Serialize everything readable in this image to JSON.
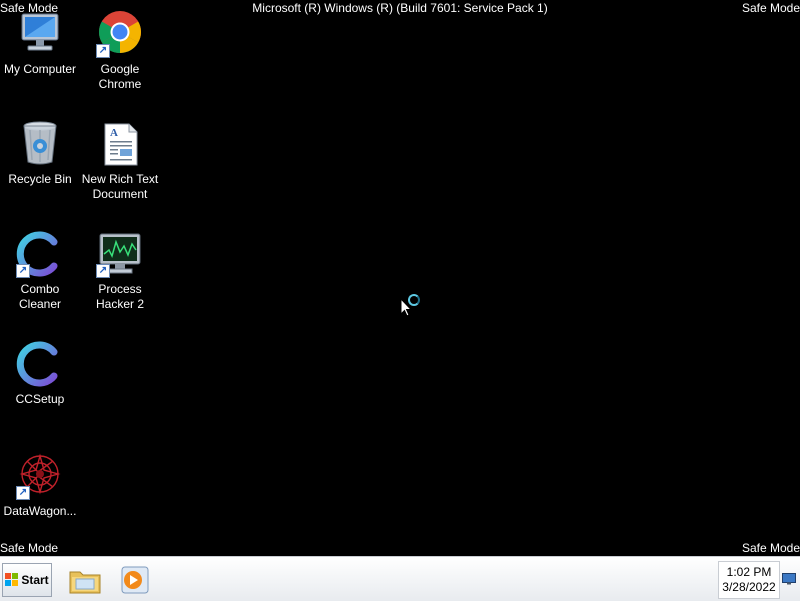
{
  "overlay": {
    "safe_mode_tl": "Safe Mode",
    "safe_mode_tr": "Safe Mode",
    "safe_mode_bl": "Safe Mode",
    "safe_mode_br": "Safe Mode",
    "build": "Microsoft (R) Windows (R) (Build 7601: Service Pack 1)"
  },
  "desktop_icons": [
    {
      "label": "My Computer",
      "icon": "computer-icon"
    },
    {
      "label": "Google Chrome",
      "icon": "chrome-icon"
    },
    {
      "label": "Recycle Bin",
      "icon": "recycle-bin-icon"
    },
    {
      "label": "New Rich Text Document",
      "icon": "rich-text-document-icon"
    },
    {
      "label": "Combo Cleaner",
      "icon": "combo-cleaner-icon"
    },
    {
      "label": "Process Hacker 2",
      "icon": "process-hacker-icon"
    },
    {
      "label": "CCSetup",
      "icon": "ccsetup-icon"
    },
    {
      "label": "DataWagon...",
      "icon": "datawagon-icon"
    }
  ],
  "taskbar": {
    "start_label": "Start",
    "pinned": [
      "file-explorer-icon",
      "media-player-icon"
    ]
  },
  "tray": {
    "time": "1:02 PM",
    "date": "3/28/2022"
  },
  "colors": {
    "desktop": "#000000",
    "taskbar": "#eef0f3",
    "spinner": "#5ec9e3"
  }
}
